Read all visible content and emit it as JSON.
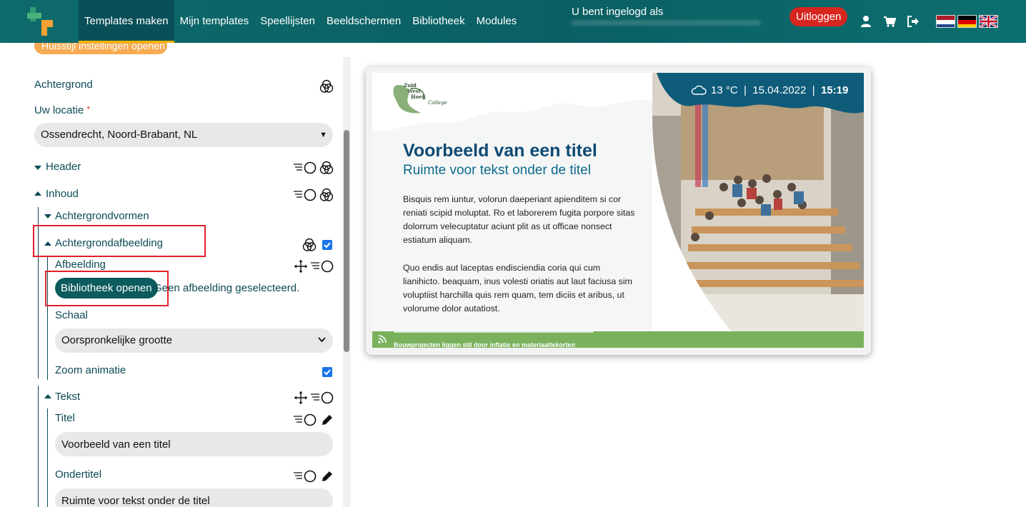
{
  "nav": {
    "items": [
      {
        "label": "Templates maken",
        "active": true
      },
      {
        "label": "Mijn templates"
      },
      {
        "label": "Speellijsten"
      },
      {
        "label": "Beeldschermen"
      },
      {
        "label": "Bibliotheek"
      },
      {
        "label": "Modules"
      }
    ],
    "login_label": "U bent ingelogd als",
    "logout_label": "Uitloggen"
  },
  "colors": {
    "brand": "#0a5f63",
    "accent": "#f4b400",
    "danger": "#d6261f",
    "preview_title": "#0e4a73",
    "ticker": "#79b15c"
  },
  "panel": {
    "cut_pill": "Huisstijl instellingen openen",
    "background_label": "Achtergrond",
    "location_label": "Uw locatie",
    "location_required": "*",
    "location_value": "Ossendrecht,  Noord-Brabant,  NL",
    "header_label": "Header",
    "inhoud_label": "Inhoud",
    "achtergrondvormen_label": "Achtergrondvormen",
    "achtergrondafbeelding_label": "Achtergrondafbeelding",
    "afbeelding_label": "Afbeelding",
    "library_button": "Bibliotheek openen",
    "no_image_text": "Geen afbeelding geselecteerd.",
    "schaal_label": "Schaal",
    "schaal_value": "Oorspronkelijke grootte",
    "zoom_label": "Zoom animatie",
    "tekst_label": "Tekst",
    "titel_label": "Titel",
    "titel_value": "Voorbeeld van een titel",
    "ondertitel_label": "Ondertitel",
    "ondertitel_value": "Ruimte voor tekst onder de titel"
  },
  "preview": {
    "weather_temp": "13 °C",
    "weather_sep": "|",
    "weather_date": "15.04.2022",
    "weather_time": "15:19",
    "logo_lines": [
      "Zuid",
      "West",
      "Hoek",
      "College"
    ],
    "title": "Voorbeeld van een titel",
    "subtitle": "Ruimte voor tekst onder de titel",
    "paragraph1": "Bisquis rem iuntur, volorun daeperiant apienditem si cor reniati scipid moluptat. Ro et laborerem fugita porpore sitas dolorrum velecuptatur aciunt plit as ut officae nonsect estiatum aliquam.",
    "paragraph2": "Quo endis aut laceptas endisciendia coria qui cum lianihicto. beaquam, inus volesti oriatis aut laut faciusa sim voluptiist harchilla quis rem quam, tem diciis et aribus, ut volorume dolor autatiost.",
    "ticker_text": "Bouwprojecten liggen stil door inflatie en materiaaltekorten"
  }
}
